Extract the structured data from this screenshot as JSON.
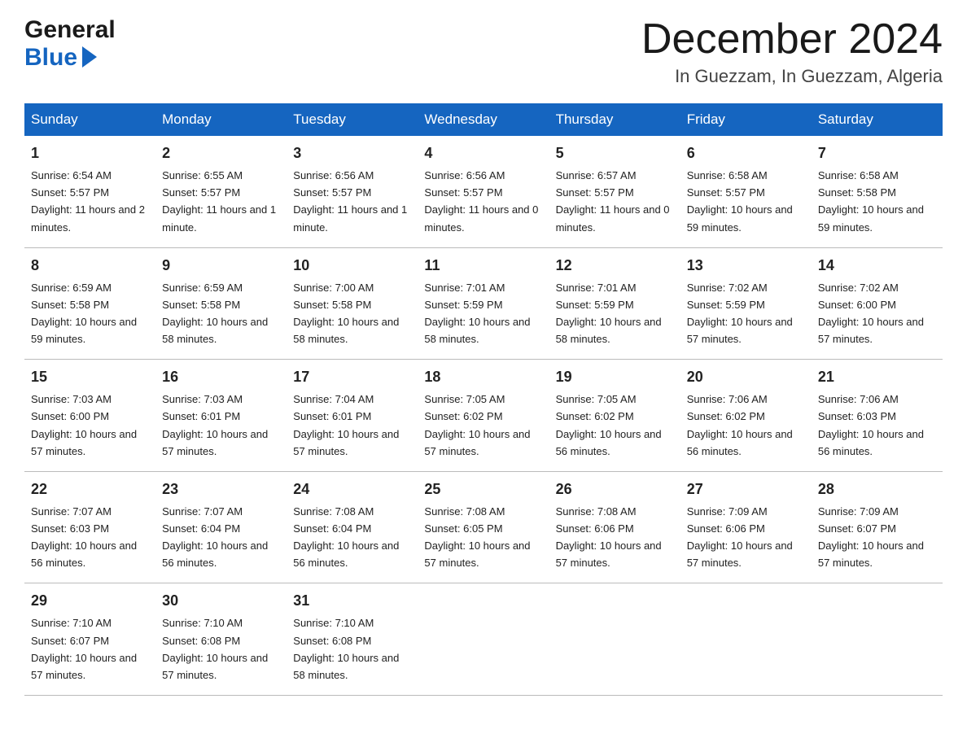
{
  "header": {
    "logo_line1": "General",
    "logo_line2": "Blue",
    "month_title": "December 2024",
    "location": "In Guezzam, In Guezzam, Algeria"
  },
  "days_of_week": [
    "Sunday",
    "Monday",
    "Tuesday",
    "Wednesday",
    "Thursday",
    "Friday",
    "Saturday"
  ],
  "weeks": [
    [
      {
        "day": "1",
        "sunrise": "6:54 AM",
        "sunset": "5:57 PM",
        "daylight": "11 hours and 2 minutes."
      },
      {
        "day": "2",
        "sunrise": "6:55 AM",
        "sunset": "5:57 PM",
        "daylight": "11 hours and 1 minute."
      },
      {
        "day": "3",
        "sunrise": "6:56 AM",
        "sunset": "5:57 PM",
        "daylight": "11 hours and 1 minute."
      },
      {
        "day": "4",
        "sunrise": "6:56 AM",
        "sunset": "5:57 PM",
        "daylight": "11 hours and 0 minutes."
      },
      {
        "day": "5",
        "sunrise": "6:57 AM",
        "sunset": "5:57 PM",
        "daylight": "11 hours and 0 minutes."
      },
      {
        "day": "6",
        "sunrise": "6:58 AM",
        "sunset": "5:57 PM",
        "daylight": "10 hours and 59 minutes."
      },
      {
        "day": "7",
        "sunrise": "6:58 AM",
        "sunset": "5:58 PM",
        "daylight": "10 hours and 59 minutes."
      }
    ],
    [
      {
        "day": "8",
        "sunrise": "6:59 AM",
        "sunset": "5:58 PM",
        "daylight": "10 hours and 59 minutes."
      },
      {
        "day": "9",
        "sunrise": "6:59 AM",
        "sunset": "5:58 PM",
        "daylight": "10 hours and 58 minutes."
      },
      {
        "day": "10",
        "sunrise": "7:00 AM",
        "sunset": "5:58 PM",
        "daylight": "10 hours and 58 minutes."
      },
      {
        "day": "11",
        "sunrise": "7:01 AM",
        "sunset": "5:59 PM",
        "daylight": "10 hours and 58 minutes."
      },
      {
        "day": "12",
        "sunrise": "7:01 AM",
        "sunset": "5:59 PM",
        "daylight": "10 hours and 58 minutes."
      },
      {
        "day": "13",
        "sunrise": "7:02 AM",
        "sunset": "5:59 PM",
        "daylight": "10 hours and 57 minutes."
      },
      {
        "day": "14",
        "sunrise": "7:02 AM",
        "sunset": "6:00 PM",
        "daylight": "10 hours and 57 minutes."
      }
    ],
    [
      {
        "day": "15",
        "sunrise": "7:03 AM",
        "sunset": "6:00 PM",
        "daylight": "10 hours and 57 minutes."
      },
      {
        "day": "16",
        "sunrise": "7:03 AM",
        "sunset": "6:01 PM",
        "daylight": "10 hours and 57 minutes."
      },
      {
        "day": "17",
        "sunrise": "7:04 AM",
        "sunset": "6:01 PM",
        "daylight": "10 hours and 57 minutes."
      },
      {
        "day": "18",
        "sunrise": "7:05 AM",
        "sunset": "6:02 PM",
        "daylight": "10 hours and 57 minutes."
      },
      {
        "day": "19",
        "sunrise": "7:05 AM",
        "sunset": "6:02 PM",
        "daylight": "10 hours and 56 minutes."
      },
      {
        "day": "20",
        "sunrise": "7:06 AM",
        "sunset": "6:02 PM",
        "daylight": "10 hours and 56 minutes."
      },
      {
        "day": "21",
        "sunrise": "7:06 AM",
        "sunset": "6:03 PM",
        "daylight": "10 hours and 56 minutes."
      }
    ],
    [
      {
        "day": "22",
        "sunrise": "7:07 AM",
        "sunset": "6:03 PM",
        "daylight": "10 hours and 56 minutes."
      },
      {
        "day": "23",
        "sunrise": "7:07 AM",
        "sunset": "6:04 PM",
        "daylight": "10 hours and 56 minutes."
      },
      {
        "day": "24",
        "sunrise": "7:08 AM",
        "sunset": "6:04 PM",
        "daylight": "10 hours and 56 minutes."
      },
      {
        "day": "25",
        "sunrise": "7:08 AM",
        "sunset": "6:05 PM",
        "daylight": "10 hours and 57 minutes."
      },
      {
        "day": "26",
        "sunrise": "7:08 AM",
        "sunset": "6:06 PM",
        "daylight": "10 hours and 57 minutes."
      },
      {
        "day": "27",
        "sunrise": "7:09 AM",
        "sunset": "6:06 PM",
        "daylight": "10 hours and 57 minutes."
      },
      {
        "day": "28",
        "sunrise": "7:09 AM",
        "sunset": "6:07 PM",
        "daylight": "10 hours and 57 minutes."
      }
    ],
    [
      {
        "day": "29",
        "sunrise": "7:10 AM",
        "sunset": "6:07 PM",
        "daylight": "10 hours and 57 minutes."
      },
      {
        "day": "30",
        "sunrise": "7:10 AM",
        "sunset": "6:08 PM",
        "daylight": "10 hours and 57 minutes."
      },
      {
        "day": "31",
        "sunrise": "7:10 AM",
        "sunset": "6:08 PM",
        "daylight": "10 hours and 58 minutes."
      },
      null,
      null,
      null,
      null
    ]
  ],
  "labels": {
    "sunrise": "Sunrise:",
    "sunset": "Sunset:",
    "daylight": "Daylight:"
  }
}
